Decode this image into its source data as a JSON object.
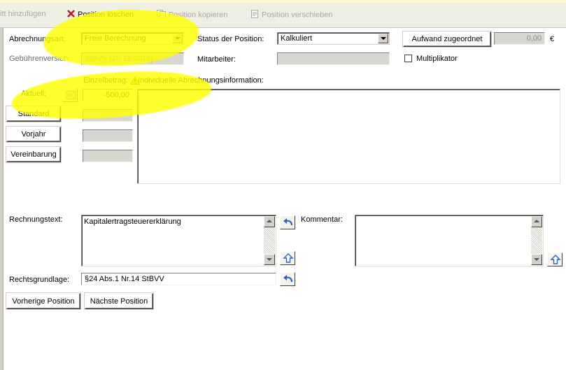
{
  "toolbar": {
    "add_label": "itt hinzufügen",
    "delete_label": "Position löschen",
    "copy_label": "Position kopieren",
    "move_label": "Position verschieben"
  },
  "form": {
    "billing_type_label": "Abrechnungsart:",
    "billing_type_value": "Freie Berechnung",
    "fee_version_label": "Gebührenversion:",
    "fee_version_value": "StBVV (20.12.2012)",
    "status_label": "Status der Position:",
    "status_value": "Kalkuliert",
    "employee_label": "Mitarbeiter:",
    "employee_value": "",
    "effort_button_label": "Aufwand zugeordnet",
    "effort_value": "0,00",
    "currency": "€",
    "multiplier_label": "Multiplikator",
    "single_amount_label": "Einzelbetrag:",
    "individual_info_label": "Individuelle Abrechnungsinformation:",
    "current_label": "Aktuell:",
    "current_value": "-500,00",
    "standard_button_label": "Standard",
    "previous_year_button_label": "Vorjahr",
    "agreement_button_label": "Vereinbarung",
    "invoice_text_label": "Rechnungstext:",
    "invoice_text_value": "Kapitalertragsteuererklärung",
    "comment_label": "Kommentar:",
    "comment_value": "",
    "legal_basis_label": "Rechtsgrundlage:",
    "legal_basis_value": "§24 Abs.1 Nr.14 StBVV",
    "prev_position_label": "Vorherige Position",
    "next_position_label": "Nächste Position"
  },
  "colors": {
    "highlight": "#ffff00",
    "amount_field": "#ffffe1",
    "toolbar": "#f0efe6",
    "delete_icon": "#d01010"
  }
}
